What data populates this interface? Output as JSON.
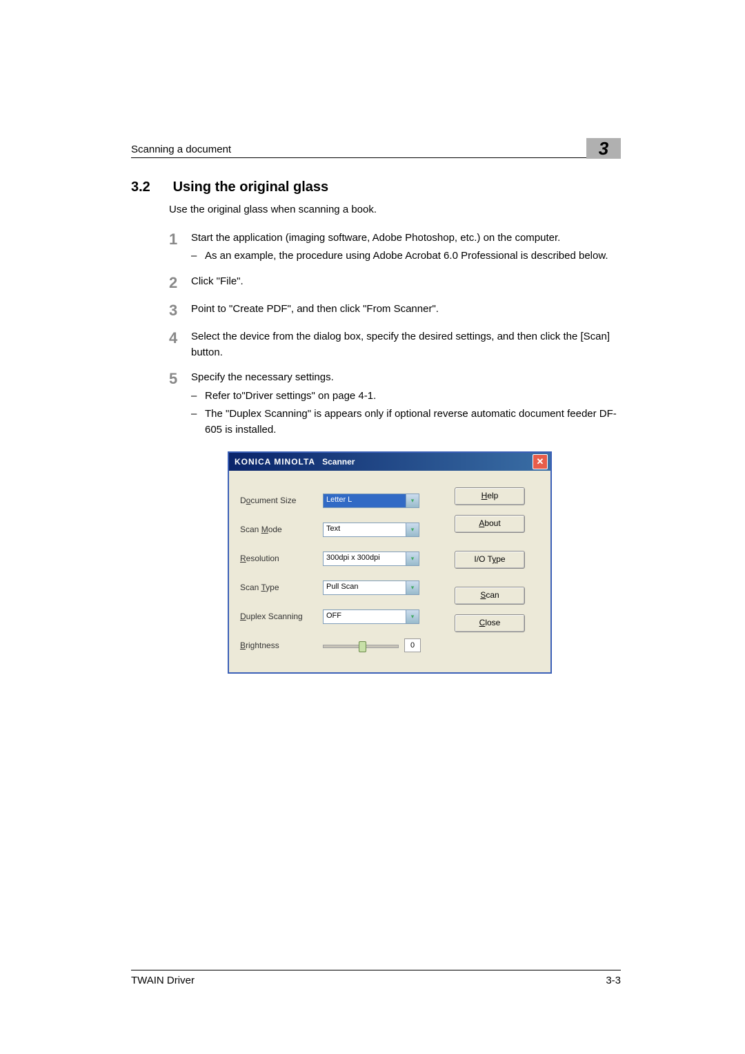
{
  "header": {
    "running_head": "Scanning a document",
    "chapter_number": "3"
  },
  "section": {
    "number": "3.2",
    "title": "Using the original glass",
    "intro": "Use the original glass when scanning a book."
  },
  "steps": [
    {
      "num": "1",
      "text": "Start the application (imaging software, Adobe Photoshop, etc.) on the computer.",
      "subs": [
        "As an example, the procedure using Adobe Acrobat 6.0 Professional is described below."
      ]
    },
    {
      "num": "2",
      "text": "Click \"File\".",
      "subs": []
    },
    {
      "num": "3",
      "text": "Point to \"Create PDF\", and then click \"From Scanner\".",
      "subs": []
    },
    {
      "num": "4",
      "text": "Select the device from the dialog box, specify the desired settings, and then click the [Scan] button.",
      "subs": []
    },
    {
      "num": "5",
      "text": "Specify the necessary settings.",
      "subs": [
        "Refer to\"Driver settings\" on page 4-1.",
        "The \"Duplex Scanning\" is appears only if optional reverse automatic document feeder DF-605 is installed."
      ]
    }
  ],
  "dialog": {
    "brand": "KONICA MINOLTA",
    "title_suffix": "Scanner",
    "close_glyph": "✕",
    "rows": {
      "document_size": {
        "label_pre": "D",
        "label_mn": "o",
        "label_post": "cument Size",
        "value": "Letter L",
        "selected": true
      },
      "scan_mode": {
        "label_pre": "Scan ",
        "label_mn": "M",
        "label_post": "ode",
        "value": "Text",
        "selected": false
      },
      "resolution": {
        "label_pre": "",
        "label_mn": "R",
        "label_post": "esolution",
        "value": "300dpi x 300dpi",
        "selected": false
      },
      "scan_type": {
        "label_pre": "Scan ",
        "label_mn": "T",
        "label_post": "ype",
        "value": "Pull Scan",
        "selected": false
      },
      "duplex": {
        "label_pre": "",
        "label_mn": "D",
        "label_post": "uplex Scanning",
        "value": "OFF",
        "selected": false
      }
    },
    "brightness": {
      "label_pre": "",
      "label_mn": "B",
      "label_post": "rightness",
      "value": "0"
    },
    "buttons": {
      "help": {
        "pre": "",
        "mn": "H",
        "post": "elp"
      },
      "about": {
        "pre": "",
        "mn": "A",
        "post": "bout"
      },
      "iotype": {
        "pre": "I/O T",
        "mn": "y",
        "post": "pe"
      },
      "scan": {
        "pre": "",
        "mn": "S",
        "post": "can"
      },
      "close": {
        "pre": "",
        "mn": "C",
        "post": "lose"
      }
    },
    "chevron": "▾"
  },
  "footer": {
    "left": "TWAIN Driver",
    "right": "3-3"
  }
}
